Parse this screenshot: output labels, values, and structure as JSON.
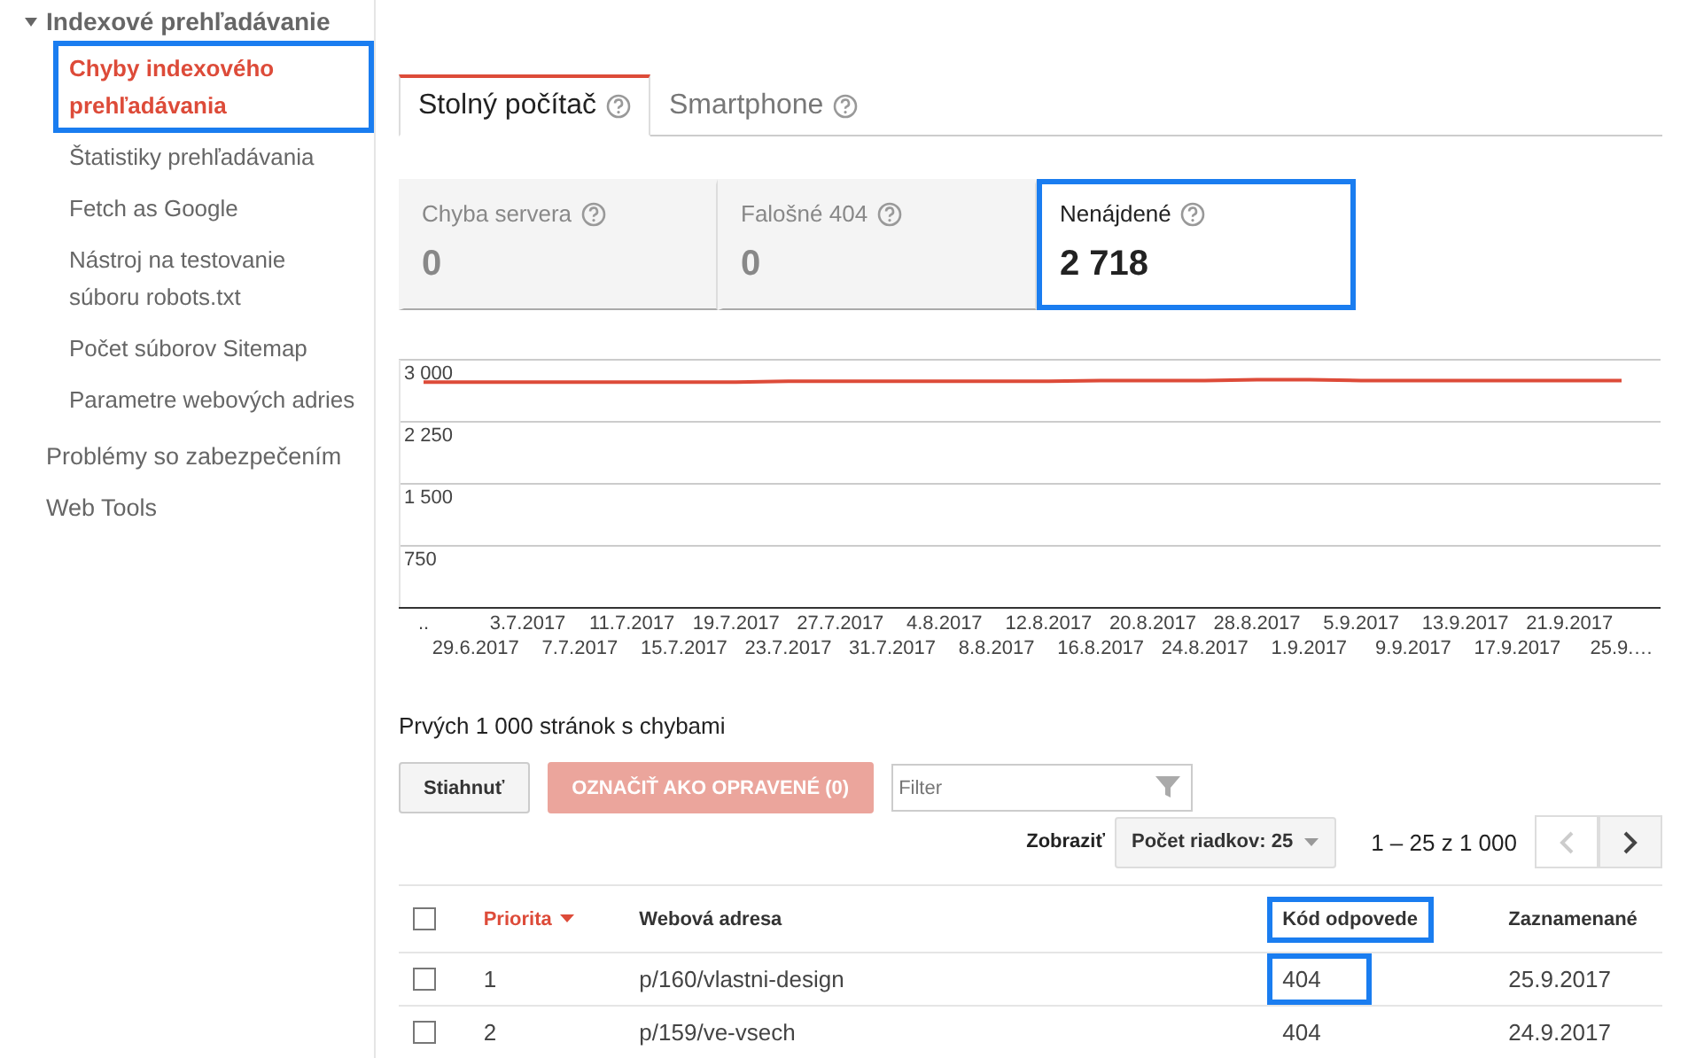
{
  "sidebar": {
    "section": {
      "label": "Indexové prehľadávanie",
      "expanded": true,
      "children": [
        {
          "label": "Chyby indexového prehľadávania",
          "selected": true,
          "highlighted": true
        },
        {
          "label": "Štatistiky prehľadávania",
          "selected": false,
          "highlighted": false
        },
        {
          "label": "Fetch as Google",
          "selected": false,
          "highlighted": false
        },
        {
          "label": "Nástroj na testovanie súboru robots.txt",
          "selected": false,
          "highlighted": false
        },
        {
          "label": "Počet súborov Sitemap",
          "selected": false,
          "highlighted": false
        },
        {
          "label": "Parametre webových adries",
          "selected": false,
          "highlighted": false
        }
      ]
    },
    "items": [
      {
        "label": "Problémy so zabezpečením"
      },
      {
        "label": "Web Tools"
      }
    ]
  },
  "tabs": [
    {
      "label": "Stolný počítač",
      "selected": true
    },
    {
      "label": "Smartphone",
      "selected": false
    }
  ],
  "metrics": [
    {
      "label": "Chyba servera",
      "value": "0",
      "selected": false,
      "highlighted": false
    },
    {
      "label": "Falošné 404",
      "value": "0",
      "selected": false,
      "highlighted": false
    },
    {
      "label": "Nenájdené",
      "value": "2 718",
      "selected": true,
      "highlighted": true
    }
  ],
  "chart": {
    "chart_data": {
      "type": "line",
      "categories": [
        "..",
        "29.6.2017",
        "3.7.2017",
        "7.7.2017",
        "11.7.2017",
        "15.7.2017",
        "19.7.2017",
        "23.7.2017",
        "27.7.2017",
        "31.7.2017",
        "4.8.2017",
        "8.8.2017",
        "12.8.2017",
        "16.8.2017",
        "20.8.2017",
        "24.8.2017",
        "28.8.2017",
        "1.9.2017",
        "5.9.2017",
        "9.9.2017",
        "13.9.2017",
        "17.9.2017",
        "21.9.2017",
        "25.9.…"
      ],
      "series": [
        {
          "color": "#dd4b39",
          "values": [
            2730,
            2730,
            2730,
            2730,
            2730,
            2730,
            2730,
            2740,
            2740,
            2740,
            2740,
            2740,
            2740,
            2750,
            2750,
            2750,
            2760,
            2760,
            2750,
            2750,
            2750,
            2750,
            2750,
            2750
          ]
        }
      ],
      "grid": true,
      "ylim": [
        0,
        3000
      ],
      "yticks": [
        {
          "value": 750,
          "label": "750"
        },
        {
          "value": 1500,
          "label": "1 500"
        },
        {
          "value": 2250,
          "label": "2 250"
        },
        {
          "value": 3000,
          "label": "3 000"
        }
      ]
    }
  },
  "table_title": "Prvých 1 000 stránok s chybami",
  "toolbar": {
    "download_button": "Stiahnuť",
    "mark_fixed_button": {
      "label": "OZNAČIŤ AKO OPRAVENÉ (0)",
      "disabled": true
    },
    "filter": {
      "placeholder": "Filter"
    },
    "show_label": "Zobraziť",
    "rows_dropdown": "Počet riadkov: 25",
    "range": "1 – 25 z 1 000",
    "prev_disabled": true
  },
  "table": {
    "all_checked": false,
    "columns": [
      {
        "label": "Priorita",
        "sorted": true,
        "highlighted": false
      },
      {
        "label": "Webová adresa",
        "sorted": false,
        "highlighted": false
      },
      {
        "label": "Kód odpovede",
        "sorted": false,
        "highlighted": true
      },
      {
        "label": "Zaznamenané",
        "sorted": false,
        "highlighted": false
      }
    ],
    "rows": [
      {
        "checked": false,
        "cells": [
          {
            "text": "1",
            "highlighted": false
          },
          {
            "text": "p/160/vlastni-design",
            "highlighted": false
          },
          {
            "text": "404",
            "highlighted": true
          },
          {
            "text": "25.9.2017",
            "highlighted": false
          }
        ]
      },
      {
        "checked": false,
        "cells": [
          {
            "text": "2",
            "highlighted": false
          },
          {
            "text": "p/159/ve-vsech",
            "highlighted": false
          },
          {
            "text": "404",
            "highlighted": false
          },
          {
            "text": "24.9.2017",
            "highlighted": false
          }
        ]
      }
    ]
  }
}
